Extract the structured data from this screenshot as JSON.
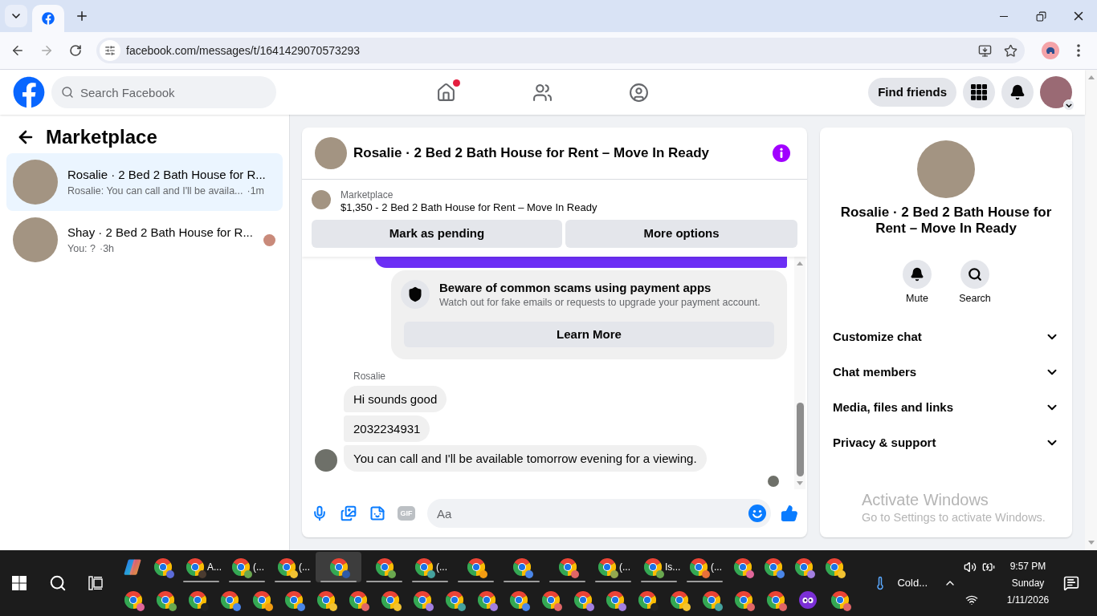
{
  "browser": {
    "tabs": [
      {
        "selected": true
      }
    ],
    "url": "facebook.com/messages/t/1641429070573293"
  },
  "header": {
    "search": {
      "placeholder": "Search Facebook"
    },
    "nav": [
      {
        "kind": "home",
        "notification": true
      },
      {
        "kind": "friends",
        "notification": false
      },
      {
        "kind": "groups",
        "notification": false
      }
    ],
    "find_friends": "Find friends"
  },
  "sidebar": {
    "title": "Marketplace",
    "conversations": [
      {
        "title": "Rosalie · 2 Bed 2 Bath House for R...",
        "preview": "Rosalie: You can call and I'll be availa...",
        "time": "·1m",
        "selected": true,
        "seen": false
      },
      {
        "title": "Shay · 2 Bed 2 Bath House for R...",
        "preview": "You: ?",
        "time": "·3h",
        "selected": false,
        "seen": true
      }
    ]
  },
  "chat": {
    "title": "Rosalie · 2 Bed 2 Bath House for Rent – Move In Ready",
    "listing": {
      "source": "Marketplace",
      "summary": "$1,350 - 2 Bed 2 Bath House for Rent – Move In Ready",
      "actions": [
        "Mark as pending",
        "More options"
      ]
    },
    "messages": [
      {
        "kind": "outgoing_clipped"
      },
      {
        "kind": "notice",
        "title": "Beware of common scams using payment apps",
        "body": "Watch out for fake emails or requests to upgrade your payment account.",
        "action": "Learn More"
      },
      {
        "kind": "incoming_group",
        "sender": "Rosalie",
        "texts": [
          "Hi sounds good",
          "2032234931",
          "You can call and I'll be available tomorrow evening for a viewing."
        ]
      }
    ],
    "read_receipt": true,
    "composer": {
      "tools": [
        {
          "kind": "mic"
        },
        {
          "kind": "photo"
        },
        {
          "kind": "sticker"
        },
        {
          "kind": "gif",
          "label": "GIF"
        }
      ],
      "placeholder": "Aa"
    }
  },
  "details": {
    "name": "Rosalie · 2 Bed 2 Bath House for Rent – Move In Ready",
    "actions": [
      {
        "kind": "mute",
        "label": "Mute"
      },
      {
        "kind": "search",
        "label": "Search"
      }
    ],
    "sections": [
      {
        "label": "Customize chat",
        "expanded": false
      },
      {
        "label": "Chat members",
        "expanded": false
      },
      {
        "label": "Media, files and links",
        "expanded": false
      },
      {
        "label": "Privacy & support",
        "expanded": false
      }
    ]
  },
  "activation_notice": {
    "title": "Activate Windows",
    "body": "Go to Settings to activate Windows."
  },
  "taskbar": {
    "rows": [
      [
        {
          "kind": "copilot",
          "open": false,
          "selected": false
        },
        {
          "kind": "browser",
          "color": "#5b6bd8",
          "open": false,
          "selected": false
        },
        {
          "kind": "browser",
          "color": "#4a3b30",
          "open": true,
          "selected": false,
          "label": "A..."
        },
        {
          "kind": "browser",
          "color": "#6aa84f",
          "open": true,
          "selected": false,
          "label": "(..."
        },
        {
          "kind": "browser",
          "color": "#f1c232",
          "open": true,
          "selected": false,
          "label": "(..."
        },
        {
          "kind": "browser",
          "color": "#2e5aa8",
          "open": true,
          "selected": true
        },
        {
          "kind": "browser",
          "color": "#6aa84f",
          "open": true,
          "selected": false
        },
        {
          "kind": "browser",
          "color": "#45a29e",
          "open": true,
          "selected": false,
          "label": "(..."
        },
        {
          "kind": "browser",
          "color": "#f39c12",
          "open": true,
          "selected": false
        },
        {
          "kind": "browser",
          "color": "#4a86e8",
          "open": true,
          "selected": false
        },
        {
          "kind": "browser",
          "color": "#e06666",
          "open": true,
          "selected": false
        },
        {
          "kind": "browser",
          "color": "#93a84f",
          "open": true,
          "selected": false,
          "label": "(..."
        },
        {
          "kind": "browser",
          "color": "#6aa84f",
          "open": true,
          "selected": false,
          "label": "Is..."
        },
        {
          "kind": "browser",
          "color": "#e8703a",
          "open": true,
          "selected": false,
          "label": "(..."
        },
        {
          "kind": "browser",
          "color": "#e06699",
          "open": false,
          "selected": false
        },
        {
          "kind": "browser",
          "color": "#4a86e8",
          "open": false,
          "selected": false
        },
        {
          "kind": "browser",
          "color": "#a27fe0",
          "open": false,
          "selected": false
        },
        {
          "kind": "browser",
          "color": "#f1c232",
          "open": false,
          "selected": false
        }
      ],
      [
        {
          "kind": "browser",
          "color": "#e06699",
          "open": false,
          "selected": false
        },
        {
          "kind": "browser",
          "color": "#6aa84f",
          "open": false,
          "selected": false
        },
        {
          "kind": "browser",
          "color": "#222222",
          "open": false,
          "selected": false
        },
        {
          "kind": "browser",
          "color": "#4a86e8",
          "open": false,
          "selected": false
        },
        {
          "kind": "browser",
          "color": "#f39c12",
          "open": false,
          "selected": false
        },
        {
          "kind": "browser",
          "color": "#4a86e8",
          "open": false,
          "selected": false
        },
        {
          "kind": "browser",
          "color": "#f1c232",
          "open": false,
          "selected": false
        },
        {
          "kind": "browser",
          "color": "#e06666",
          "open": false,
          "selected": false
        },
        {
          "kind": "browser",
          "color": "#f1c232",
          "open": false,
          "selected": false
        },
        {
          "kind": "browser",
          "color": "#a27fe0",
          "open": false,
          "selected": false
        },
        {
          "kind": "browser",
          "color": "#45a29e",
          "open": false,
          "selected": false
        },
        {
          "kind": "browser",
          "color": "#a27fe0",
          "open": false,
          "selected": false
        },
        {
          "kind": "browser",
          "color": "#4a86e8",
          "open": false,
          "selected": false
        },
        {
          "kind": "browser",
          "color": "#e06666",
          "open": false,
          "selected": false
        },
        {
          "kind": "browser",
          "color": "#a27fe0",
          "open": false,
          "selected": false
        },
        {
          "kind": "browser",
          "color": "#a27fe0",
          "open": false,
          "selected": false
        },
        {
          "kind": "browser",
          "color": "#222222",
          "open": false,
          "selected": false
        },
        {
          "kind": "browser",
          "color": "#f1c232",
          "open": false,
          "selected": false
        },
        {
          "kind": "browser",
          "color": "#45a29e",
          "open": false,
          "selected": false
        },
        {
          "kind": "browser",
          "color": "#e06666",
          "open": false,
          "selected": false
        },
        {
          "kind": "browser",
          "color": "#e06666",
          "open": false,
          "selected": false
        },
        {
          "kind": "app",
          "color": "#7b2fd6",
          "open": false,
          "selected": false
        },
        {
          "kind": "browser",
          "color": "#e06666",
          "open": false,
          "selected": false
        }
      ]
    ],
    "weather": "Cold...",
    "clock": {
      "time": "9:57 PM",
      "day": "Sunday",
      "date": "1/11/2026"
    }
  }
}
